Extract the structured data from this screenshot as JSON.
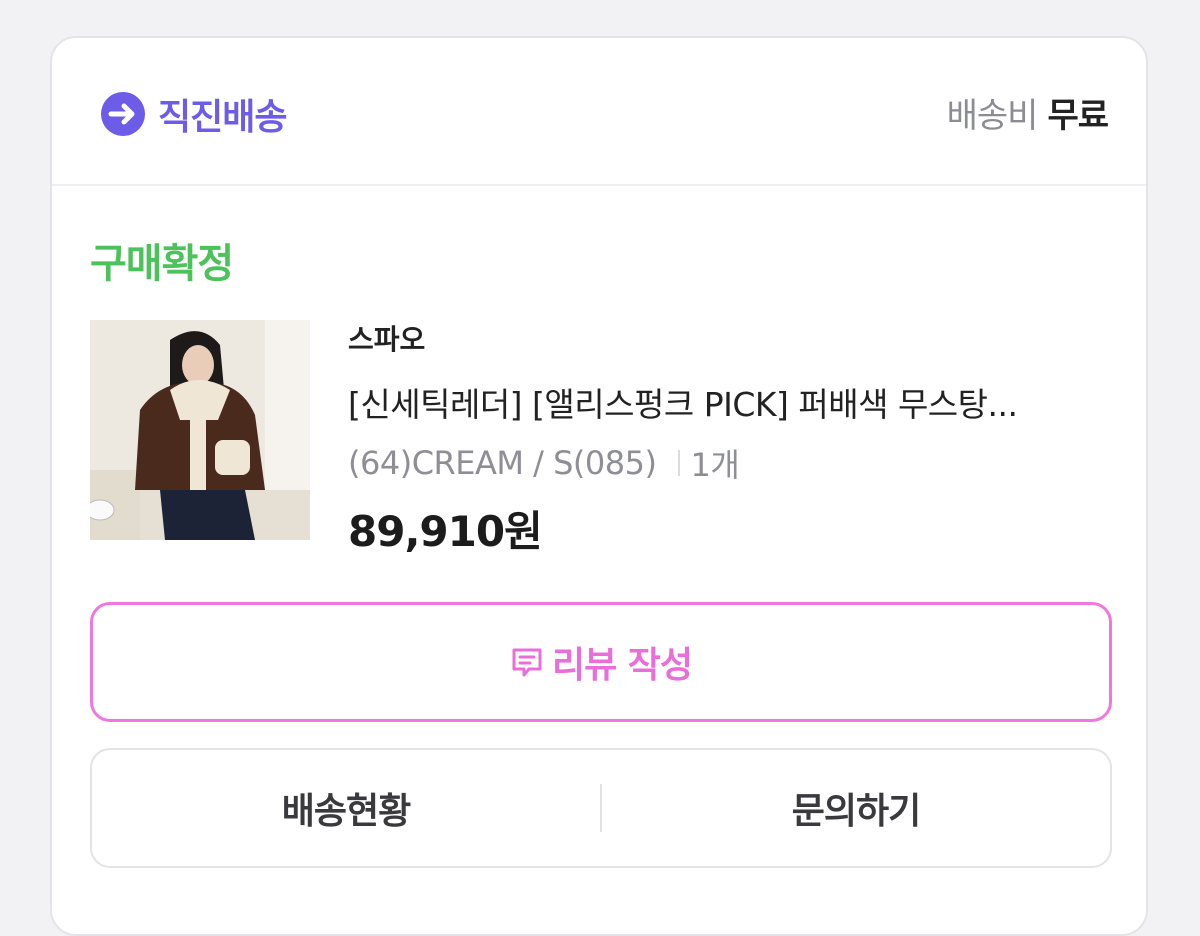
{
  "delivery": {
    "label": "직진배송",
    "icon": "arrow-circle-icon",
    "color": "#6c5ce7"
  },
  "shipping": {
    "label": "배송비",
    "value": "무료"
  },
  "order": {
    "status": "구매확정",
    "status_color": "#4cc25a",
    "brand": "스파오",
    "title": "[신세틱레더] [앨리스펑크 PICK] 퍼배색 무스탕...",
    "option": "(64)CREAM / S(085)",
    "quantity": "1개",
    "price": "89,910원"
  },
  "buttons": {
    "review": "리뷰 작성",
    "review_icon": "comment-icon",
    "review_color": "#ea6ed9",
    "delivery_status": "배송현황",
    "inquiry": "문의하기"
  }
}
